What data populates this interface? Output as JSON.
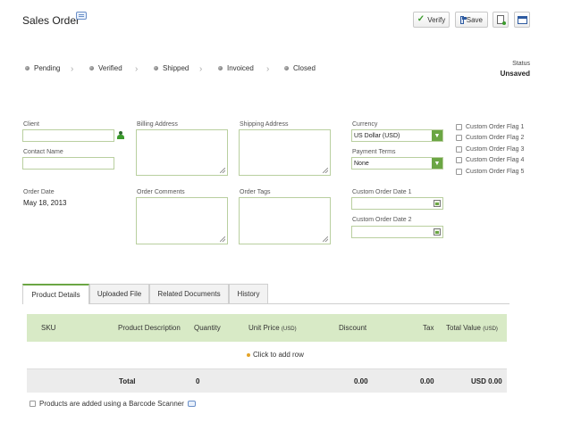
{
  "page": {
    "title": "Sales Order"
  },
  "toolbar": {
    "verify_label": "Verify",
    "save_label": "Save"
  },
  "steps": [
    "Pending",
    "Verified",
    "Shipped",
    "Invoiced",
    "Closed"
  ],
  "status": {
    "label": "Status",
    "value": "Unsaved"
  },
  "form": {
    "client_label": "Client",
    "contact_label": "Contact Name",
    "order_date_label": "Order Date",
    "order_date_value": "May 18, 2013",
    "billing_label": "Billing Address",
    "shipping_label": "Shipping Address",
    "comments_label": "Order Comments",
    "tags_label": "Order Tags",
    "currency_label": "Currency",
    "currency_value": "US Dollar (USD)",
    "terms_label": "Payment Terms",
    "terms_value": "None",
    "date1_label": "Custom Order Date 1",
    "date2_label": "Custom Order Date 2"
  },
  "flags": [
    "Custom Order Flag 1",
    "Custom Order Flag 2",
    "Custom Order Flag 3",
    "Custom Order Flag 4",
    "Custom Order Flag 5"
  ],
  "tabs": [
    "Product Details",
    "Uploaded File",
    "Related Documents",
    "History"
  ],
  "grid": {
    "columns": {
      "sku": "SKU",
      "description": "Product Description",
      "quantity": "Quantity",
      "unit_price": "Unit Price",
      "unit_price_unit": "(USD)",
      "discount": "Discount",
      "tax": "Tax",
      "total_value": "Total Value",
      "total_value_unit": "(USD)"
    },
    "add_row": "Click to add row",
    "totals": {
      "label": "Total",
      "quantity": "0",
      "discount": "0.00",
      "tax": "0.00",
      "total_value": "USD 0.00"
    }
  },
  "barcode": {
    "label": "Products are added using a Barcode Scanner"
  },
  "colors": {
    "accent_green": "#6ba644",
    "header_green": "#d8eac6",
    "field_border": "#b9cf9f"
  },
  "icons": [
    "comment-icon",
    "verify-check-icon",
    "save-disk-icon",
    "new-document-icon",
    "window-icon",
    "client-lookup-icon",
    "calendar-icon",
    "dropdown-arrow-icon",
    "add-row-dot-icon",
    "help-bubble-icon"
  ]
}
